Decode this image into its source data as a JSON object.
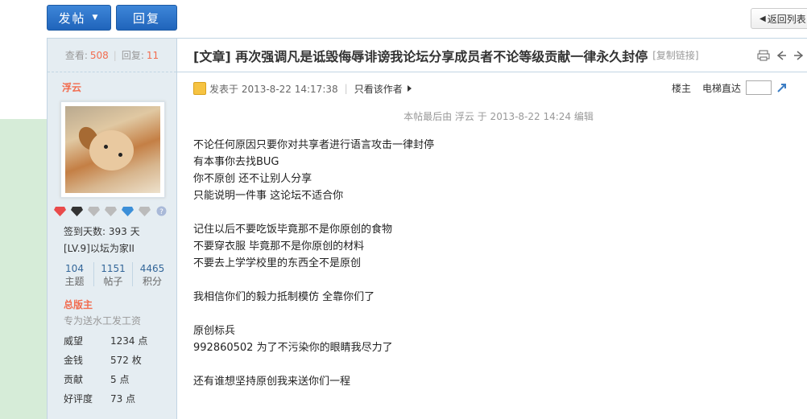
{
  "toolbar": {
    "post_label": "发帖",
    "reply_label": "回复",
    "back_label": "返回列表"
  },
  "stats": {
    "views_label": "查看:",
    "views": "508",
    "replies_label": "回复:",
    "replies": "11"
  },
  "author": {
    "name": "浮云",
    "signin_days": "签到天数: 393 天",
    "level": "[LV.9]以坛为家II",
    "counts": [
      {
        "value": "104",
        "label": "主题"
      },
      {
        "value": "1151",
        "label": "帖子"
      },
      {
        "value": "4465",
        "label": "积分"
      }
    ],
    "group": "总版主",
    "group_desc": "专为送水工发工资",
    "attrs": [
      {
        "key": "威望",
        "value": "1234 点"
      },
      {
        "key": "金钱",
        "value": "572 枚"
      },
      {
        "key": "贡献",
        "value": "5 点"
      },
      {
        "key": "好评度",
        "value": "73 点"
      }
    ]
  },
  "post": {
    "title": "[文章] 再次强调凡是诋毁侮辱诽谤我论坛分享成员者不论等级贡献一律永久封停",
    "copy_link": "[复制链接]",
    "posted_at": "发表于 2013-8-22 14:17:38",
    "only_author": "只看该作者",
    "floor_label": "楼主",
    "elevator_label": "电梯直达",
    "edit_note": "本帖最后由 浮云 于 2013-8-22 14:24 编辑",
    "paragraphs": [
      [
        "不论任何原因只要你对共享者进行语言攻击一律封停",
        "有本事你去找BUG",
        "你不原创 还不让别人分享",
        "只能说明一件事 这论坛不适合你"
      ],
      [
        "记住以后不要吃饭毕竟那不是你原创的食物",
        "不要穿衣服 毕竟那不是你原创的材料",
        "不要去上学学校里的东西全不是原创"
      ],
      [
        "我相信你们的毅力抵制模仿 全靠你们了"
      ],
      [
        "原创标兵",
        "992860502 为了不污染你的眼睛我尽力了"
      ],
      [
        "还有谁想坚持原创我来送你们一程"
      ]
    ]
  }
}
